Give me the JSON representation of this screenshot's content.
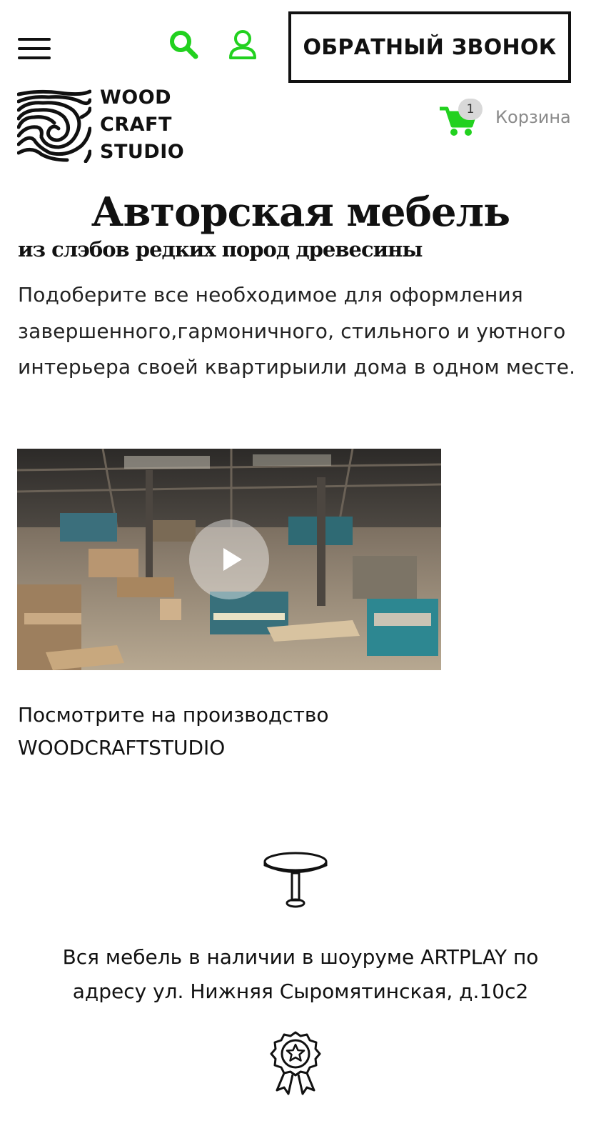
{
  "header": {
    "callback_label": "ОБРАТНЫЙ ЗВОНОК",
    "logo": {
      "lines": [
        "WOOD",
        "CRAFT",
        "STUDIO"
      ]
    },
    "cart": {
      "count": "1",
      "label": "Корзина"
    }
  },
  "colors": {
    "accent": "#22d11f",
    "text": "#111111",
    "muted": "#8a8a8a",
    "badge_bg": "#d8d8d8"
  },
  "icons": {
    "menu": "hamburger-icon",
    "search": "search-icon",
    "user": "user-icon",
    "cart": "cart-icon",
    "play": "play-icon",
    "table": "table-icon",
    "award": "award-icon"
  },
  "hero": {
    "title": "Авторская мебель",
    "subtitle": "из слэбов редких пород древесины",
    "description": "Подоберите все необходимое для оформления завершенного,гармоничного, стильного и уютного интерьера своей квартирыили дома в одном месте."
  },
  "video": {
    "caption_line1": "Посмотрите на производство",
    "caption_line2": "WOODCRAFTSTUDIO"
  },
  "features": [
    {
      "line1": "Вся мебель в наличии в шоуруме ARTPLAY по",
      "line2": "адресу ул. Нижняя Сыромятинская, д.10с2"
    }
  ]
}
